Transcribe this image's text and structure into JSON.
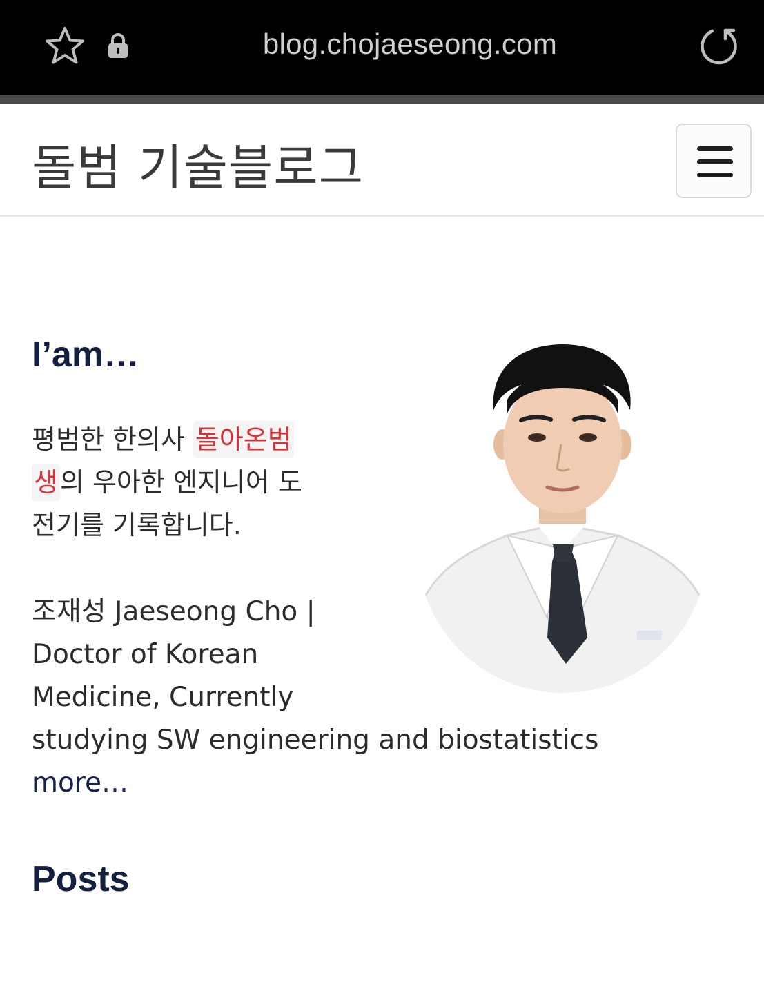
{
  "browser": {
    "url": "blog.chojaeseong.com",
    "icons": [
      "star-icon",
      "lock-icon",
      "reload-icon"
    ]
  },
  "header": {
    "site_title": "돌범 기술블로그",
    "menu_icon": "hamburger-menu-icon"
  },
  "about": {
    "heading": "I’am…",
    "intro_1": "평범한 한의사 ",
    "tag_1a": "돌아온범",
    "tag_1b": "생",
    "intro_2": "의 우아한 엔지니어 도",
    "intro_3": "전기를 기록합니다.",
    "bio_1": "조재성 Jaeseong Cho |",
    "bio_2": "Doctor of Korean",
    "bio_3": "Medicine, Currently",
    "bio_4": "studying SW engineering and biostatistics",
    "more_link": "more…"
  },
  "posts": {
    "heading": "Posts"
  },
  "colors": {
    "heading": "#13203f",
    "tag_text": "#d9303a",
    "browser_bar": "#000000"
  }
}
